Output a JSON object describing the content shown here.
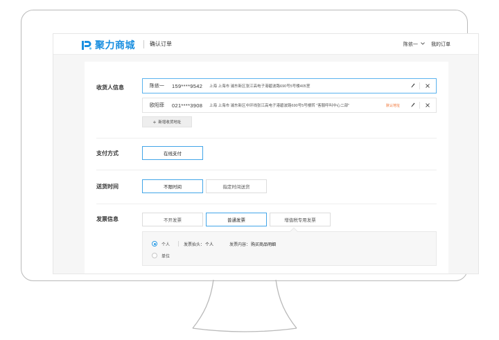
{
  "header": {
    "logo_text": "聚力商城",
    "page_title": "确认订单",
    "user_name": "陈依一",
    "my_orders": "我的订单"
  },
  "sections": {
    "address_label": "收货人信息",
    "payment_label": "支付方式",
    "delivery_label": "送货时间",
    "invoice_label": "发票信息"
  },
  "addresses": [
    {
      "name": "陈依一",
      "phone": "159****9542",
      "detail": "上海 上海市 浦东新区张江高电子港碧波路690号5号楼405室",
      "default_tag": "",
      "selected": true
    },
    {
      "name": "欧阳菲",
      "phone": "021****3908",
      "detail": "上海 上海市 浦东新区中环线张江高电子港碧波路690号5号楼转 \"客服呼叫中心二部\"",
      "default_tag": "默认地址",
      "selected": false
    }
  ],
  "add_address_label": "新增收货地址",
  "payment_options": [
    "在线支付"
  ],
  "delivery_options": [
    "不限时间",
    "指定时间送货"
  ],
  "invoice_options": [
    "不开发票",
    "普通发票",
    "增值税专用发票"
  ],
  "invoice_panel": {
    "personal_label": "个人",
    "company_label": "单位",
    "title_prefix": "发票抬头：",
    "title_value": "个人",
    "content_prefix": "发票内容：",
    "content_value": "购买商品明细"
  },
  "icons": {
    "edit": "pencil-icon",
    "delete": "close-icon",
    "dropdown": "chevron-down-icon",
    "add": "plus-icon"
  },
  "colors": {
    "accent": "#1a8fe0",
    "selected_border": "#42a5e8",
    "default_tag": "#f07030"
  }
}
